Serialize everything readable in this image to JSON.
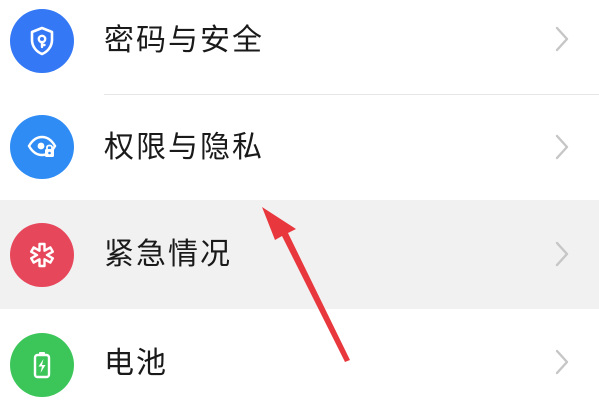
{
  "settings": {
    "items": [
      {
        "label": "密码与安全",
        "icon": "shield-lock-icon",
        "color": "#3478f6"
      },
      {
        "label": "权限与隐私",
        "icon": "eye-lock-icon",
        "color": "#2f8cf5"
      },
      {
        "label": "紧急情况",
        "icon": "medical-asterisk-icon",
        "color": "#e7475b"
      },
      {
        "label": "电池",
        "icon": "battery-charging-icon",
        "color": "#3cc65a"
      }
    ]
  },
  "annotation": {
    "arrow_color": "#e8383d"
  }
}
